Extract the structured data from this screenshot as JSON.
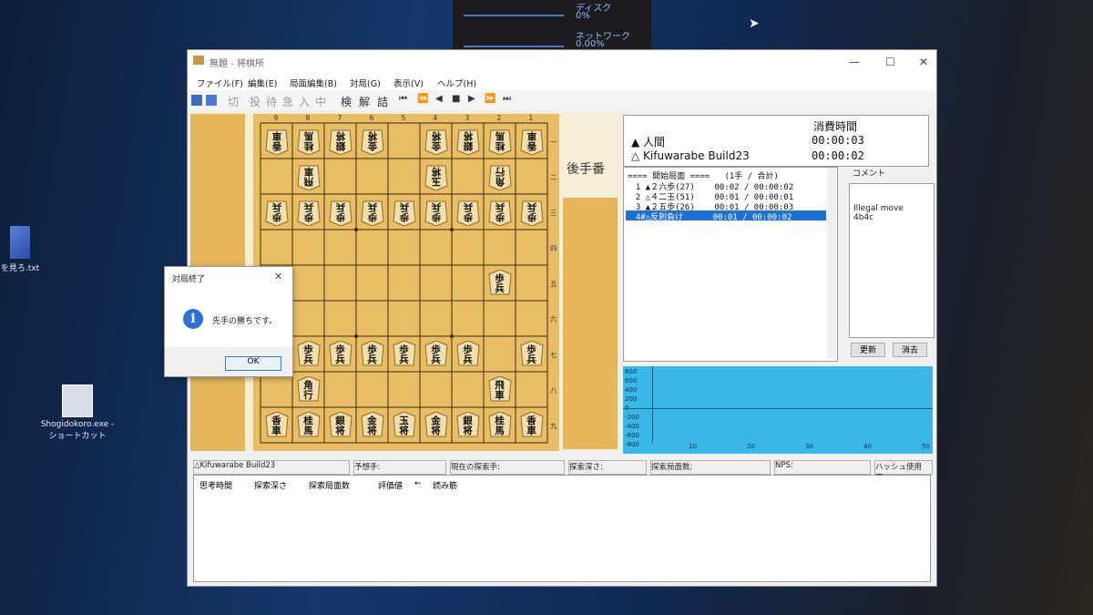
{
  "perf": {
    "disk_label": "ディスク",
    "disk_value": "0%",
    "net_label": "ネットワーク",
    "net_value": "0.00%"
  },
  "desktop": {
    "icon1_label": "を見ろ.txt",
    "icon2_line1": "Shogidokoro.exe -",
    "icon2_line2": "ショートカット"
  },
  "window": {
    "title": "無題 - 将棋所"
  },
  "menu": [
    "ファイル(F)",
    "編集(E)",
    "局面編集(B)",
    "対局(G)",
    "表示(V)",
    "ヘルプ(H)"
  ],
  "toolbar": [
    "切",
    "投",
    "待",
    "急",
    "入",
    "中",
    "検",
    "解",
    "詰",
    "⏮",
    "⏪",
    "◀",
    "■",
    "▶",
    "⏩",
    "⏭"
  ],
  "board": {
    "files": [
      "9",
      "8",
      "7",
      "6",
      "5",
      "4",
      "3",
      "2",
      "1"
    ],
    "ranks": [
      "一",
      "二",
      "三",
      "四",
      "五",
      "六",
      "七",
      "八",
      "九"
    ],
    "pieces": [
      {
        "f": 9,
        "r": 1,
        "k": "香車",
        "side": "gote"
      },
      {
        "f": 8,
        "r": 1,
        "k": "桂馬",
        "side": "gote"
      },
      {
        "f": 7,
        "r": 1,
        "k": "銀将",
        "side": "gote"
      },
      {
        "f": 6,
        "r": 1,
        "k": "金将",
        "side": "gote"
      },
      {
        "f": 4,
        "r": 1,
        "k": "金将",
        "side": "gote"
      },
      {
        "f": 3,
        "r": 1,
        "k": "銀将",
        "side": "gote"
      },
      {
        "f": 2,
        "r": 1,
        "k": "桂馬",
        "side": "gote"
      },
      {
        "f": 1,
        "r": 1,
        "k": "香車",
        "side": "gote"
      },
      {
        "f": 8,
        "r": 2,
        "k": "飛車",
        "side": "gote"
      },
      {
        "f": 4,
        "r": 2,
        "k": "玉将",
        "side": "gote"
      },
      {
        "f": 2,
        "r": 2,
        "k": "角行",
        "side": "gote"
      },
      {
        "f": 9,
        "r": 3,
        "k": "歩兵",
        "side": "gote"
      },
      {
        "f": 8,
        "r": 3,
        "k": "歩兵",
        "side": "gote"
      },
      {
        "f": 7,
        "r": 3,
        "k": "歩兵",
        "side": "gote"
      },
      {
        "f": 6,
        "r": 3,
        "k": "歩兵",
        "side": "gote"
      },
      {
        "f": 5,
        "r": 3,
        "k": "歩兵",
        "side": "gote"
      },
      {
        "f": 4,
        "r": 3,
        "k": "歩兵",
        "side": "gote"
      },
      {
        "f": 3,
        "r": 3,
        "k": "歩兵",
        "side": "gote"
      },
      {
        "f": 2,
        "r": 3,
        "k": "歩兵",
        "side": "gote"
      },
      {
        "f": 1,
        "r": 3,
        "k": "歩兵",
        "side": "gote"
      },
      {
        "f": 2,
        "r": 5,
        "k": "歩兵",
        "side": "sente"
      },
      {
        "f": 8,
        "r": 7,
        "k": "歩兵",
        "side": "sente"
      },
      {
        "f": 7,
        "r": 7,
        "k": "歩兵",
        "side": "sente"
      },
      {
        "f": 6,
        "r": 7,
        "k": "歩兵",
        "side": "sente"
      },
      {
        "f": 5,
        "r": 7,
        "k": "歩兵",
        "side": "sente"
      },
      {
        "f": 4,
        "r": 7,
        "k": "歩兵",
        "side": "sente"
      },
      {
        "f": 3,
        "r": 7,
        "k": "歩兵",
        "side": "sente"
      },
      {
        "f": 1,
        "r": 7,
        "k": "歩兵",
        "side": "sente"
      },
      {
        "f": 8,
        "r": 8,
        "k": "角行",
        "side": "sente"
      },
      {
        "f": 2,
        "r": 8,
        "k": "飛車",
        "side": "sente"
      },
      {
        "f": 9,
        "r": 9,
        "k": "香車",
        "side": "sente"
      },
      {
        "f": 8,
        "r": 9,
        "k": "桂馬",
        "side": "sente"
      },
      {
        "f": 7,
        "r": 9,
        "k": "銀将",
        "side": "sente"
      },
      {
        "f": 6,
        "r": 9,
        "k": "金将",
        "side": "sente"
      },
      {
        "f": 5,
        "r": 9,
        "k": "玉将",
        "side": "sente"
      },
      {
        "f": 4,
        "r": 9,
        "k": "金将",
        "side": "sente"
      },
      {
        "f": 3,
        "r": 9,
        "k": "銀将",
        "side": "sente"
      },
      {
        "f": 2,
        "r": 9,
        "k": "桂馬",
        "side": "sente"
      },
      {
        "f": 1,
        "r": 9,
        "k": "香車",
        "side": "sente"
      }
    ]
  },
  "turn_label": "後手番",
  "players": {
    "time_header": "消費時間",
    "sente": "▲ 人間",
    "sente_time": "00:00:03",
    "gote": "△ Kifuwarabe Build23",
    "gote_time": "00:00:02"
  },
  "kifu": {
    "header": "==== 開始局面 ====   (1手 / 合計)",
    "moves": [
      "  1 ▲２六歩(27)    00:02 / 00:00:02",
      "  2 △４二玉(51)    00:01 / 00:00:01",
      "  3 ▲２五歩(26)    00:01 / 00:00:03",
      "  4#△反則負け      00:01 / 00:00:02"
    ],
    "selected": 3
  },
  "comment": {
    "label": "コメント",
    "text": "Illegal move\n4b4c",
    "update_button": "更新",
    "clear_button": "消去"
  },
  "graph": {
    "y_ticks": [
      "800",
      "600",
      "400",
      "200",
      "0",
      "-200",
      "-400",
      "-600",
      "-800"
    ],
    "x_ticks": [
      "10",
      "20",
      "30",
      "40",
      "50"
    ]
  },
  "status": {
    "engine": "△Kifuwarabe Build23",
    "pv_label": "予想手:",
    "current_label": "現在の探索手:",
    "depth_label": "探索深さ:",
    "nodes_label": "探索局面数:",
    "nps_label": "NPS:",
    "hash_label": "ハッシュ使用率:"
  },
  "think_headers": [
    "思考時間",
    "探索深さ",
    "探索局面数",
    "評価値",
    "←",
    "読み筋"
  ],
  "dialog": {
    "title": "対局終了",
    "message": "先手の勝ちです。",
    "ok": "OK"
  }
}
